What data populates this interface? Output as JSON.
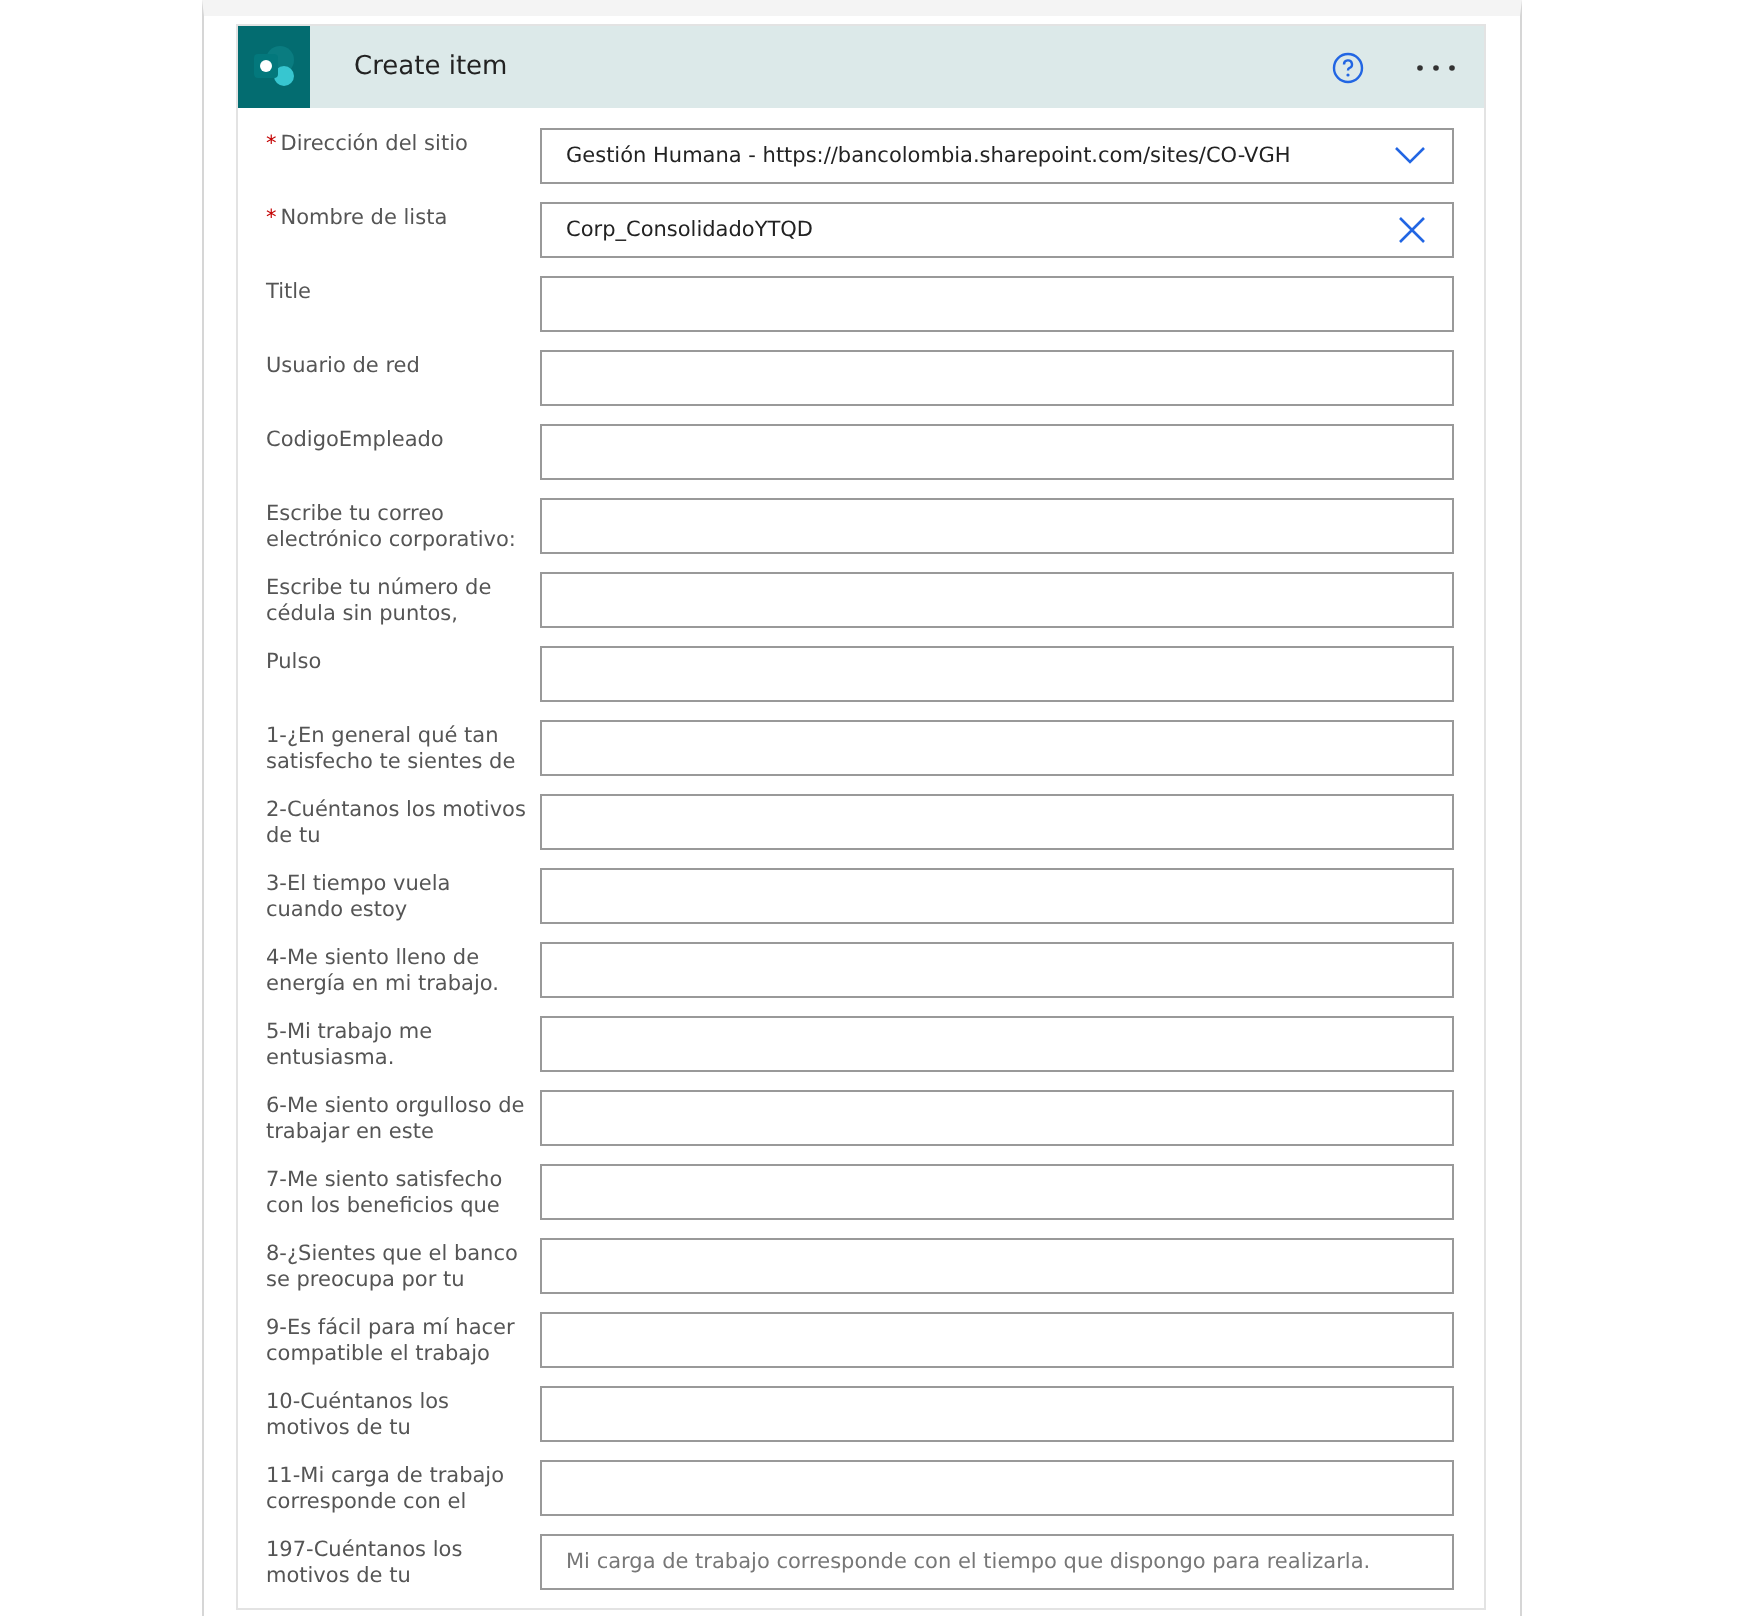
{
  "card": {
    "title": "Create item"
  },
  "fields": [
    {
      "label": "Dirección del sitio",
      "required_mark": "*",
      "kind": "dropdown",
      "value": "Gestión Humana - https://bancolombia.sharepoint.com/sites/CO-VGH"
    },
    {
      "label": "Nombre de lista",
      "required_mark": "*",
      "kind": "clearable",
      "value": "Corp_ConsolidadoYTQD"
    },
    {
      "label": "Title",
      "kind": "text"
    },
    {
      "label": "Usuario de red",
      "kind": "text"
    },
    {
      "label": "CodigoEmpleado",
      "kind": "text"
    },
    {
      "label": "Escribe tu correo electrónico corporativo:",
      "kind": "text"
    },
    {
      "label": "Escribe tu número de cédula sin puntos,",
      "kind": "text"
    },
    {
      "label": "Pulso",
      "kind": "text"
    },
    {
      "label": "1-¿En general qué tan satisfecho te sientes de",
      "kind": "text"
    },
    {
      "label": "2-Cuéntanos los motivos de tu",
      "kind": "text"
    },
    {
      "label": "3-El tiempo vuela cuando estoy",
      "kind": "text"
    },
    {
      "label": "4-Me siento lleno de energía en mi trabajo.",
      "kind": "text"
    },
    {
      "label": "5-Mi trabajo me entusiasma.",
      "kind": "text"
    },
    {
      "label": "6-Me siento orgulloso de trabajar en este",
      "kind": "text"
    },
    {
      "label": "7-Me siento satisfecho con los beneficios que",
      "kind": "text"
    },
    {
      "label": "8-¿Sientes que el banco se preocupa por tu",
      "kind": "text"
    },
    {
      "label": "9-Es fácil para mí hacer compatible el trabajo",
      "kind": "text"
    },
    {
      "label": "10-Cuéntanos los motivos de tu",
      "kind": "text"
    },
    {
      "label": "11-Mi carga de trabajo corresponde con el",
      "kind": "text"
    },
    {
      "label": "197-Cuéntanos los motivos de tu",
      "kind": "text",
      "placeholder": "Mi carga de trabajo corresponde con el tiempo que dispongo para realizarla."
    }
  ]
}
